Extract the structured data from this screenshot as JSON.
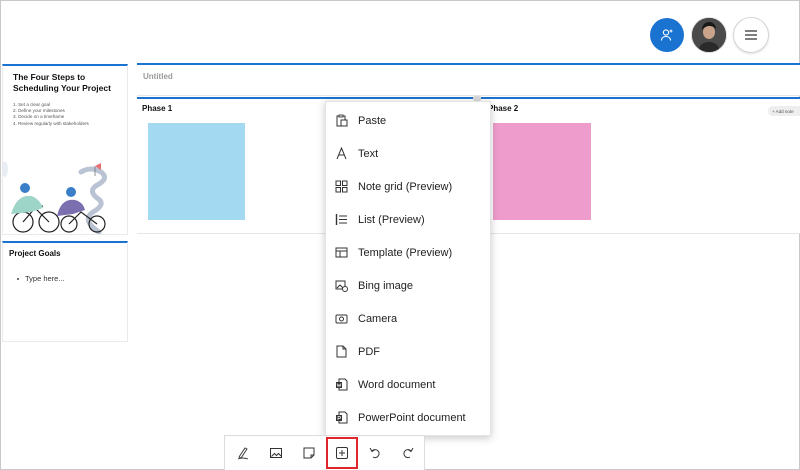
{
  "header": {
    "share_icon": "person-add-icon",
    "avatar_icon": "user-avatar",
    "menu_icon": "hamburger-menu-icon"
  },
  "left_panel": {
    "steps_card": {
      "title": "The Four Steps to Scheduling Your Project",
      "steps": [
        "1. Set a clear goal",
        "2. Define your milestones",
        "3. Decide on a timeframe",
        "4. Review regularly with stakeholders"
      ]
    },
    "goals_card": {
      "title": "Project Goals",
      "item": "Type here..."
    }
  },
  "board": {
    "title": "Untitled",
    "phase1": "Phase 1",
    "phase2": "Phase 2",
    "add_note": "+ Add note",
    "colors": {
      "accent": "#1a73d1",
      "note_blue": "#a3daf2",
      "note_pink": "#ee9ccb"
    }
  },
  "insert_menu": {
    "items": [
      {
        "label": "Paste",
        "icon": "clipboard-paste-icon"
      },
      {
        "label": "Text",
        "icon": "text-icon"
      },
      {
        "label": "Note grid (Preview)",
        "icon": "note-grid-icon"
      },
      {
        "label": "List (Preview)",
        "icon": "list-icon"
      },
      {
        "label": "Template (Preview)",
        "icon": "template-icon"
      },
      {
        "label": "Bing image",
        "icon": "bing-image-icon"
      },
      {
        "label": "Camera",
        "icon": "camera-icon"
      },
      {
        "label": "PDF",
        "icon": "pdf-icon"
      },
      {
        "label": "Word document",
        "icon": "word-document-icon"
      },
      {
        "label": "PowerPoint document",
        "icon": "powerpoint-document-icon"
      }
    ]
  },
  "toolbar": {
    "buttons": [
      "pen-icon",
      "image-icon",
      "sticky-note-icon",
      "add-icon",
      "undo-icon",
      "redo-icon"
    ],
    "active": "add-icon",
    "active_color": "#e0262a"
  }
}
